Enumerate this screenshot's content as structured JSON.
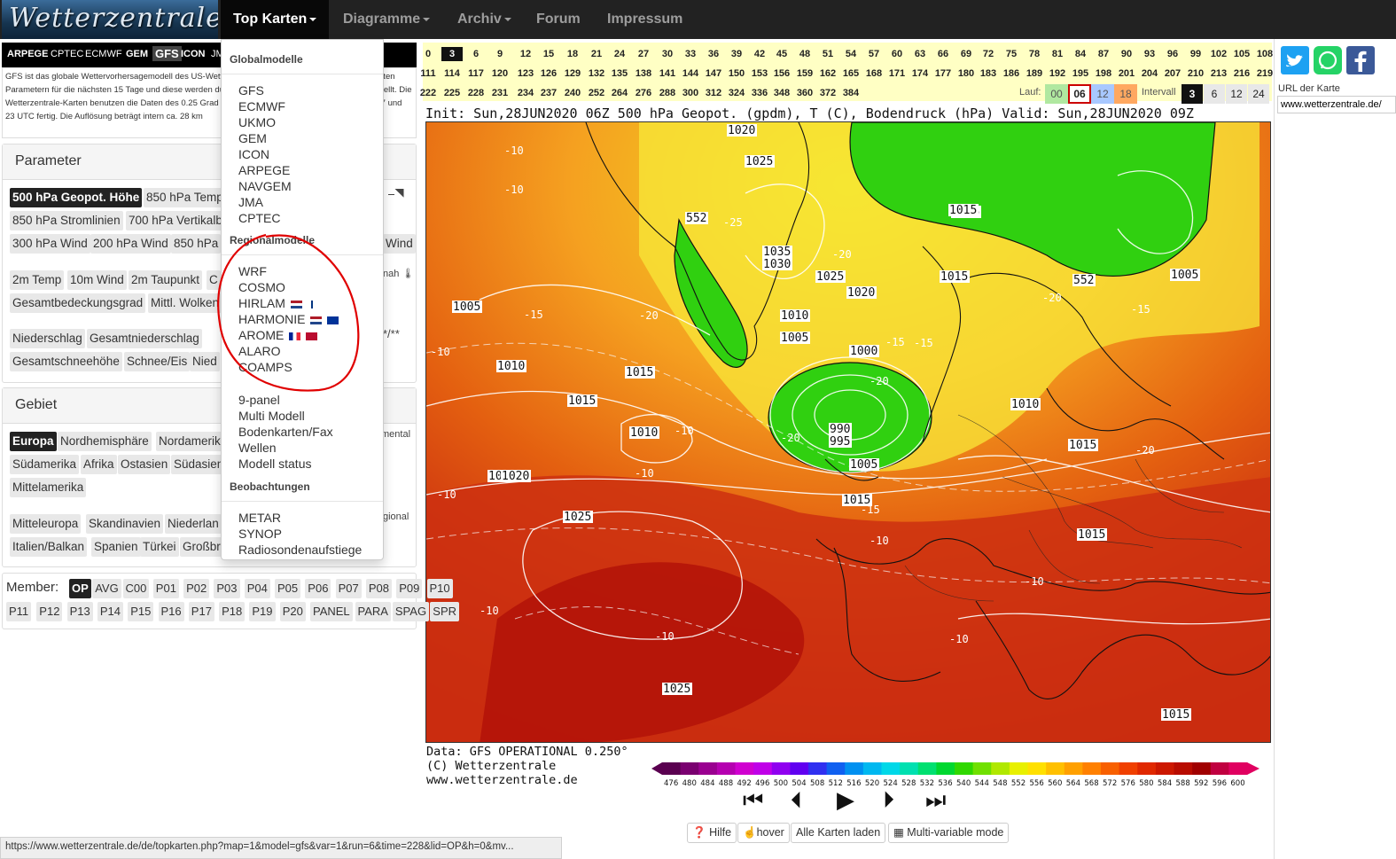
{
  "nav": {
    "logo": "Wetterzentrale",
    "items": [
      "Top Karten",
      "Diagramme",
      "Archiv",
      "Forum",
      "Impressum"
    ]
  },
  "models_bar": [
    "ARPEGE",
    "CPTEC",
    "ECMWF",
    "GEM",
    "GFS",
    "ICON",
    "JMA"
  ],
  "gfs_description": "GFS ist das globale Wettervorhersagemodell des US-Wetterdienstes, der die Prognosen aller relevanten Parametern für die nächsten 15 Tage und diese werden durch den Deutschen Wetterdienst bereitgestellt. Die Wetterzentrale-Karten benutzen die Daten des 0.25 Grad Gitters und sind normalerweise um 5, 11, 17 und 23 UTC fertig. Die Auflösung beträgt intern ca. 28 km",
  "parameter": {
    "heading": "Parameter",
    "row1": [
      "500 hPa Geopot. Höhe",
      "850 hPa Temp"
    ],
    "row2": [
      "850 hPa Stromlinien",
      "700 hPa Vertikalb"
    ],
    "row3": [
      "300 hPa Wind",
      "200 hPa Wind",
      "850 hPa",
      "Wind"
    ],
    "row4": [
      "2m Temp",
      "10m Wind",
      "2m Taupunkt",
      "C"
    ],
    "row5": [
      "Gesamtbedeckungsgrad",
      "Mittl. Wolken"
    ],
    "row6": [
      "Niederschlag",
      "Gesamtniederschlag"
    ],
    "row7": [
      "Gesamtschneehöhe",
      "Schnee/Eis",
      "Nied"
    ],
    "side_nah": "nah"
  },
  "gebiet": {
    "heading": "Gebiet",
    "row1": [
      "Europa",
      "Nordhemisphäre",
      "Nordamerik"
    ],
    "row2": [
      "Südamerika",
      "Afrika",
      "Ostasien",
      "Südasien"
    ],
    "row3": [
      "Mittelamerika"
    ],
    "row4": [
      "Mitteleuropa",
      "Skandinavien",
      "Niederlan"
    ],
    "row5": [
      "Italien/Balkan",
      "Spanien",
      "Türkei",
      "Großbr"
    ],
    "side_kontinental": "mental",
    "side_regional": "gional"
  },
  "member": {
    "label": "Member:",
    "row1": [
      "OP",
      "AVG",
      "C00",
      "P01",
      "P02",
      "P03",
      "P04",
      "P05",
      "P06",
      "P07",
      "P08",
      "P09",
      "P10"
    ],
    "row2": [
      "P11",
      "P12",
      "P13",
      "P14",
      "P15",
      "P16",
      "P17",
      "P18",
      "P19",
      "P20",
      "PANEL",
      "PARA",
      "SPAG",
      "SPR"
    ]
  },
  "dropdown": {
    "global_heading": "Globalmodelle",
    "global": [
      "GFS",
      "ECMWF",
      "UKMO",
      "GEM",
      "ICON",
      "ARPEGE",
      "NAVGEM",
      "JMA",
      "CPTEC"
    ],
    "regional_heading": "Regionalmodelle",
    "regional": [
      "WRF",
      "COSMO",
      "HIRLAM",
      "HARMONIE",
      "AROME",
      "ALARO",
      "COAMPS"
    ],
    "other": [
      "9-panel",
      "Multi Modell",
      "Bodenkarten/Fax",
      "Wellen",
      "Modell status"
    ],
    "obs_heading": "Beobachtungen",
    "obs": [
      "METAR",
      "SYNOP",
      "Radiosondenaufstiege"
    ]
  },
  "timesteps": {
    "row1": [
      "0",
      "3",
      "6",
      "9",
      "12",
      "15",
      "18",
      "21",
      "24",
      "27",
      "30",
      "33",
      "36",
      "39",
      "42",
      "45",
      "48",
      "51",
      "54",
      "57",
      "60",
      "63",
      "66",
      "69",
      "72",
      "75",
      "78",
      "81",
      "84",
      "87",
      "90",
      "93",
      "96",
      "99",
      "102",
      "105",
      "108"
    ],
    "row2": [
      "111",
      "114",
      "117",
      "120",
      "123",
      "126",
      "129",
      "132",
      "135",
      "138",
      "141",
      "144",
      "147",
      "150",
      "153",
      "156",
      "159",
      "162",
      "165",
      "168",
      "171",
      "174",
      "177",
      "180",
      "183",
      "186",
      "189",
      "192",
      "195",
      "198",
      "201",
      "204",
      "207",
      "210",
      "213",
      "216",
      "219"
    ],
    "row3": [
      "222",
      "225",
      "228",
      "231",
      "234",
      "237",
      "240",
      "252",
      "264",
      "276",
      "288",
      "300",
      "312",
      "324",
      "336",
      "348",
      "360",
      "372",
      "384"
    ],
    "selected": "3"
  },
  "run": {
    "label": "Lauf:",
    "options": [
      "00",
      "06",
      "12",
      "18"
    ],
    "selected": "06",
    "interval_label": "Intervall",
    "intervals": [
      "3",
      "6",
      "12",
      "24"
    ],
    "interval_selected": "3"
  },
  "map": {
    "title": "Init: Sun,28JUN2020 06Z 500 hPa Geopot. (gpdm), T (C), Bodendruck (hPa) Valid: Sun,28JUN2020 09Z",
    "footer1": "Data: GFS OPERATIONAL 0.250°",
    "footer2": "(C) Wetterzentrale",
    "footer3": "www.wetterzentrale.de",
    "pressure_labels": [
      "1020",
      "1025",
      "1015",
      "552",
      "1035",
      "1030",
      "1025",
      "1020",
      "1010",
      "1005",
      "1000",
      "990",
      "995",
      "1005",
      "1015",
      "1020",
      "1015",
      "1010",
      "1015",
      "1025",
      "1015",
      "1015",
      "1010",
      "1015",
      "1005",
      "552",
      "1015",
      "1010",
      "1005",
      "1020",
      "1025",
      "1015"
    ],
    "temp_labels": [
      "-10",
      "-10",
      "-25",
      "-20",
      "-15",
      "-20",
      "-15",
      "-20",
      "-15",
      "-10",
      "-20",
      "-15",
      "-10",
      "-10",
      "-10",
      "-20",
      "-10",
      "-15",
      "-10",
      "-10",
      "-10",
      "-10",
      "-20"
    ]
  },
  "legend": {
    "values": [
      "476",
      "480",
      "484",
      "488",
      "492",
      "496",
      "500",
      "504",
      "508",
      "512",
      "516",
      "520",
      "524",
      "528",
      "532",
      "536",
      "540",
      "544",
      "548",
      "552",
      "556",
      "560",
      "564",
      "568",
      "572",
      "576",
      "580",
      "584",
      "588",
      "592",
      "596",
      "600"
    ],
    "colors": [
      "#5a0050",
      "#7a0070",
      "#9a0090",
      "#b500b0",
      "#d000d0",
      "#c000e8",
      "#9000f0",
      "#6000f0",
      "#3030f0",
      "#1060f0",
      "#0090f0",
      "#00b8f0",
      "#00d8e8",
      "#00e0b0",
      "#00e070",
      "#00d830",
      "#30d800",
      "#70e000",
      "#b0e800",
      "#e8f000",
      "#ffe000",
      "#ffc000",
      "#ffa000",
      "#ff8000",
      "#f86000",
      "#f04000",
      "#e02800",
      "#cc1800",
      "#b80c00",
      "#a00000",
      "#c00040",
      "#e00060"
    ]
  },
  "player": [
    "⏮",
    "⏴",
    "▶",
    "⏵",
    "⏭"
  ],
  "tools": [
    "Hilfe",
    "hover",
    "Alle Karten laden",
    "Multi-variable mode"
  ],
  "right": {
    "url_label": "URL der Karte",
    "url_value": "www.wetterzentrale.de/"
  },
  "status_url": "https://www.wetterzentrale.de/de/topkarten.php?map=1&model=gfs&var=1&run=6&time=228&lid=OP&h=0&mv...",
  "colors": {
    "nav_bg": "#222222",
    "timestep_bg": "#ffffc4",
    "run_00": "#b0e8a0",
    "run_12": "#a8c8ff",
    "run_18": "#ffa860",
    "annotation": "#e00000"
  }
}
